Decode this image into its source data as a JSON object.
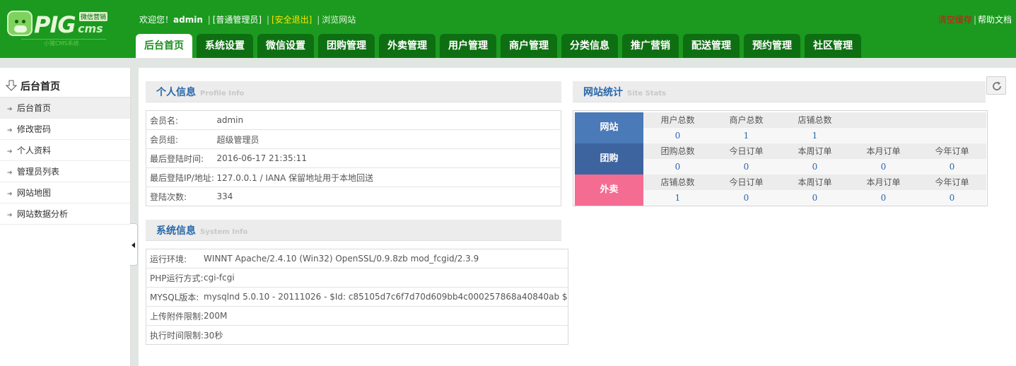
{
  "header": {
    "logo": {
      "brand": "PIG",
      "suffix": "cms",
      "tag": "微信营销",
      "sub": "小猪CMS系统"
    },
    "welcome_prefix": "欢迎您！",
    "username": "admin",
    "role": "[普通管理员]",
    "logout": "[安全退出]",
    "browse": "浏览网站",
    "clear_cache": "清空缓存",
    "help_docs": "帮助文档",
    "tabs": [
      {
        "label": "后台首页",
        "active": true
      },
      {
        "label": "系统设置"
      },
      {
        "label": "微信设置"
      },
      {
        "label": "团购管理"
      },
      {
        "label": "外卖管理"
      },
      {
        "label": "用户管理"
      },
      {
        "label": "商户管理"
      },
      {
        "label": "分类信息"
      },
      {
        "label": "推广营销"
      },
      {
        "label": "配送管理"
      },
      {
        "label": "预约管理"
      },
      {
        "label": "社区管理"
      }
    ]
  },
  "sidebar": {
    "title": "后台首页",
    "items": [
      {
        "label": "后台首页",
        "active": true
      },
      {
        "label": "修改密码"
      },
      {
        "label": "个人资料"
      },
      {
        "label": "管理员列表"
      },
      {
        "label": "网站地图"
      },
      {
        "label": "网站数据分析"
      }
    ]
  },
  "profile": {
    "title": "个人信息",
    "title_en": "Profile Info",
    "rows": [
      {
        "key": "会员名:",
        "value": "admin"
      },
      {
        "key": "会员组:",
        "value": "超级管理员"
      },
      {
        "key": "最后登陆时间:",
        "value": "2016-06-17 21:35:11"
      },
      {
        "key": "最后登陆IP/地址:",
        "value": "127.0.0.1 / IANA 保留地址用于本地回送"
      },
      {
        "key": "登陆次数:",
        "value": "334"
      }
    ]
  },
  "system": {
    "title": "系统信息",
    "title_en": "System Info",
    "rows": [
      {
        "key": "运行环境:",
        "value": "WINNT Apache/2.4.10 (Win32) OpenSSL/0.9.8zb mod_fcgid/2.3.9"
      },
      {
        "key": "PHP运行方式:",
        "value": "cgi-fcgi"
      },
      {
        "key": "MYSQL版本:",
        "value": "mysqlnd 5.0.10 - 20111026 - $Id: c85105d7c6f7d70d609bb4c000257868a40840ab $"
      },
      {
        "key": "上传附件限制:",
        "value": "200M"
      },
      {
        "key": "执行时间限制:",
        "value": "30秒"
      }
    ]
  },
  "stats": {
    "title": "网站统计",
    "title_en": "Site Stats",
    "rows": [
      {
        "label": "网站",
        "color": "#4a7ab8",
        "cells": [
          {
            "h": "用户总数",
            "v": "0"
          },
          {
            "h": "商户总数",
            "v": "1"
          },
          {
            "h": "店铺总数",
            "v": "1"
          },
          {
            "h": "",
            "v": ""
          },
          {
            "h": "",
            "v": ""
          }
        ]
      },
      {
        "label": "团购",
        "color": "#3e64a0",
        "cells": [
          {
            "h": "团购总数",
            "v": "0"
          },
          {
            "h": "今日订单",
            "v": "0"
          },
          {
            "h": "本周订单",
            "v": "0"
          },
          {
            "h": "本月订单",
            "v": "0"
          },
          {
            "h": "今年订单",
            "v": "0"
          }
        ]
      },
      {
        "label": "外卖",
        "color": "#f46c92",
        "cells": [
          {
            "h": "店铺总数",
            "v": "1"
          },
          {
            "h": "今日订单",
            "v": "0"
          },
          {
            "h": "本周订单",
            "v": "0"
          },
          {
            "h": "本月订单",
            "v": "0"
          },
          {
            "h": "今年订单",
            "v": "0"
          }
        ]
      }
    ]
  },
  "colors": {
    "header_green": "#1b9a1f",
    "tab_dark": "#0e6f12",
    "title_blue": "#2867a9",
    "danger": "#d31616",
    "logout_yellow": "#ffe400"
  }
}
